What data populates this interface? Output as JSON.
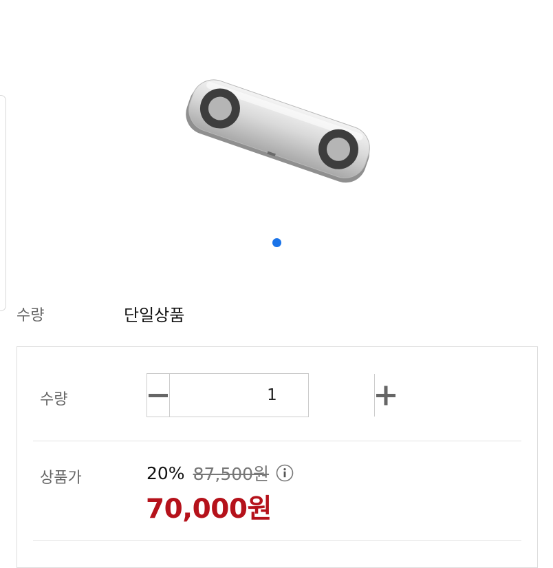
{
  "product": {
    "image_icon": "bar-device-with-two-circular-pads",
    "carousel": {
      "active_index": 1,
      "count": 1,
      "active_color": "#1a73e8"
    }
  },
  "option": {
    "label": "수량",
    "value": "단일상품"
  },
  "order": {
    "quantity_label": "수량",
    "quantity_value": "1",
    "decrement_icon": "minus-icon",
    "increment_icon": "plus-icon",
    "price_label": "상품가",
    "discount_rate": "20%",
    "original_price": "87,500원",
    "info_icon": "info-icon",
    "sale_price": "70,000원",
    "sale_price_color": "#b5121b"
  }
}
